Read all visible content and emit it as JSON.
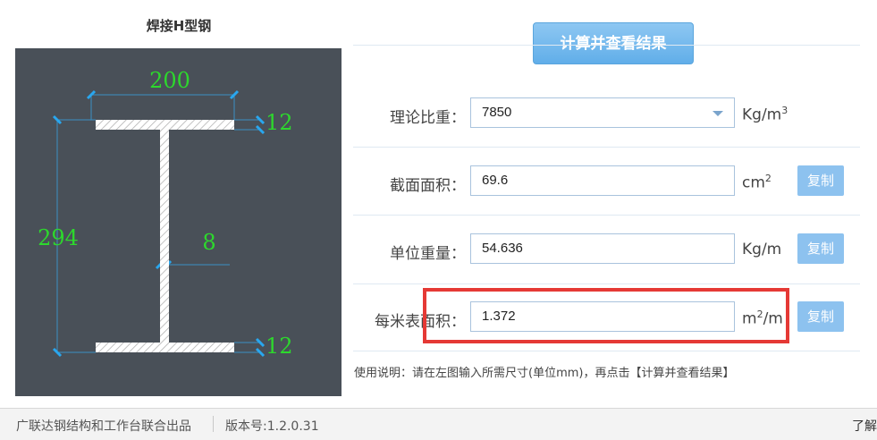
{
  "diagram": {
    "title": "焊接H型钢",
    "flange_width": "200",
    "top_flange_thickness": "12",
    "height": "294",
    "web_thickness": "8",
    "bottom_flange_thickness": "12"
  },
  "calc_button": {
    "label": "计算并查看结果"
  },
  "rows": [
    {
      "label": "理论比重：",
      "value": "7850",
      "unit": "Kg/m",
      "unit_sup": "3",
      "has_dropdown": true
    },
    {
      "label": "截面面积：",
      "value": "69.6",
      "unit": "cm",
      "unit_sup": "2",
      "copy_label": "复制"
    },
    {
      "label": "单位重量：",
      "value": "54.636",
      "unit": "Kg/m",
      "unit_sup": "",
      "copy_label": "复制"
    },
    {
      "label": "每米表面积：",
      "value": "1.372",
      "unit_prefix": "m",
      "unit_sup": "2",
      "unit_suffix": "/m",
      "copy_label": "复制"
    }
  ],
  "instructions": "使用说明：请在左图输入所需尺寸(单位mm)，再点击【计算并查看结果】",
  "footer": {
    "credit": "广联达钢结构和工作台联合出品",
    "version": "版本号:1.2.0.31",
    "more": "了解"
  },
  "colors": {
    "accent": "#61aee9",
    "dimension": "#2dd82d",
    "highlight": "#e53935",
    "diagram_bg": "#495058"
  }
}
